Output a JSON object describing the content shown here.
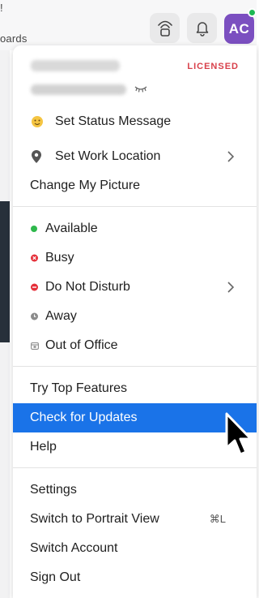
{
  "background": {
    "top_text_1": "!",
    "top_text_2": "oards"
  },
  "header": {
    "avatar_initials": "AC"
  },
  "profile": {
    "license_badge": "LICENSED"
  },
  "menu": {
    "status_section": [
      {
        "label": "Set Status Message",
        "icon": "smiley-icon"
      },
      {
        "label": "Set Work Location",
        "icon": "location-pin-icon",
        "submenu": true
      },
      {
        "label": "Change My Picture"
      }
    ],
    "presence_section": [
      {
        "label": "Available",
        "icon": "available-dot-icon",
        "color": "#2eb84c"
      },
      {
        "label": "Busy",
        "icon": "busy-icon",
        "color": "#e5303a"
      },
      {
        "label": "Do Not Disturb",
        "icon": "dnd-icon",
        "color": "#e5303a",
        "submenu": true
      },
      {
        "label": "Away",
        "icon": "away-clock-icon",
        "color": "#8a8a8a"
      },
      {
        "label": "Out of Office",
        "icon": "calendar-icon",
        "color": "#8a8a8a"
      }
    ],
    "help_section": [
      {
        "label": "Try Top Features"
      },
      {
        "label": "Check for Updates",
        "highlighted": true
      },
      {
        "label": "Help"
      }
    ],
    "account_section": [
      {
        "label": "Settings"
      },
      {
        "label": "Switch to Portrait View",
        "shortcut": "⌘L"
      },
      {
        "label": "Switch Account"
      },
      {
        "label": "Sign Out"
      }
    ]
  },
  "colors": {
    "highlight": "#1a73e8",
    "avatar": "#7b4fc0",
    "license_badge": "#d8404a",
    "presence_online": "#1db954"
  }
}
